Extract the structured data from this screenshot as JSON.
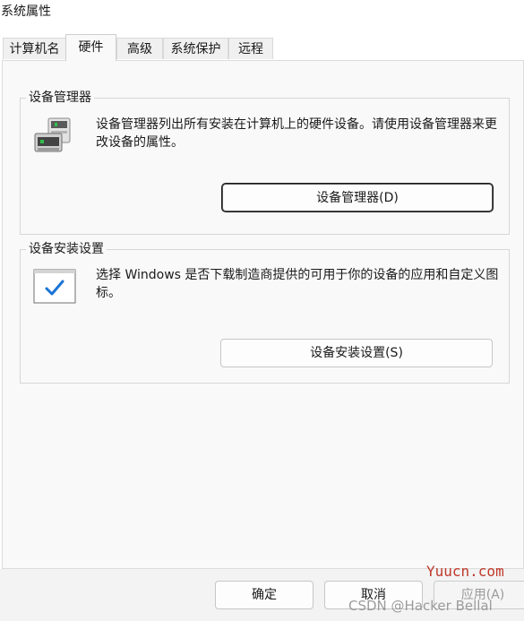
{
  "window": {
    "title": "系统属性"
  },
  "tabs": [
    {
      "label": "计算机名"
    },
    {
      "label": "硬件"
    },
    {
      "label": "高级"
    },
    {
      "label": "系统保护"
    },
    {
      "label": "远程"
    }
  ],
  "device_manager": {
    "group_label": "设备管理器",
    "description": "设备管理器列出所有安装在计算机上的硬件设备。请使用设备管理器来更改设备的属性。",
    "button_label": "设备管理器(D)"
  },
  "device_install": {
    "group_label": "设备安装设置",
    "description": "选择 Windows 是否下载制造商提供的可用于你的设备的应用和自定义图标。",
    "button_label": "设备安装设置(S)"
  },
  "footer": {
    "ok_label": "确定",
    "cancel_label": "取消",
    "apply_label": "应用(A)"
  },
  "watermarks": {
    "site": "Yuucn.com",
    "credit": "CSDN @Hacker Bellal"
  }
}
